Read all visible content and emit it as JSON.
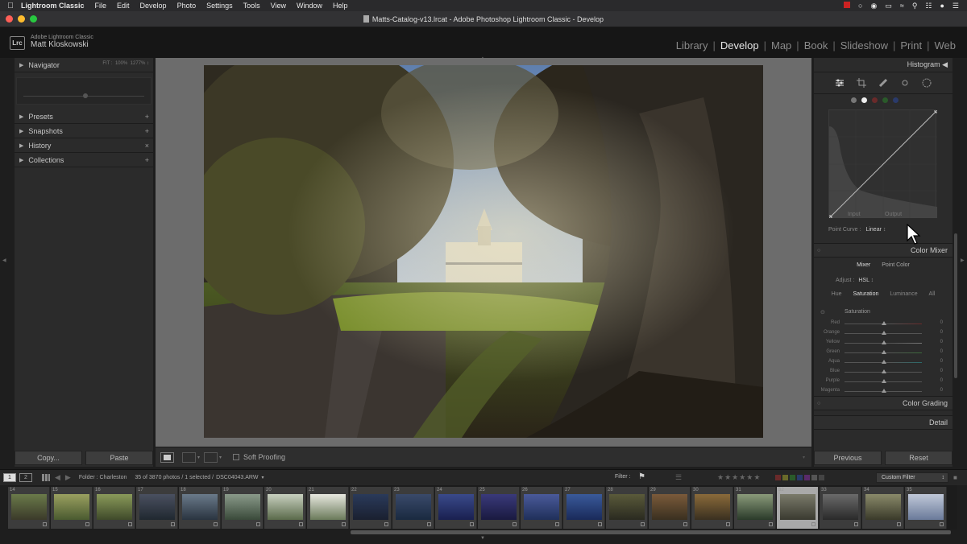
{
  "menubar": {
    "app": "Lightroom Classic",
    "items": [
      "File",
      "Edit",
      "Develop",
      "Photo",
      "Settings",
      "Tools",
      "View",
      "Window",
      "Help"
    ]
  },
  "window": {
    "title": "Matts-Catalog-v13.lrcat - Adobe Photoshop Lightroom Classic - Develop"
  },
  "identity": {
    "logo": "Lrc",
    "product": "Adobe Lightroom Classic",
    "user": "Matt Kloskowski"
  },
  "modules": [
    "Library",
    "Develop",
    "Map",
    "Book",
    "Slideshow",
    "Print",
    "Web"
  ],
  "left_panel": {
    "navigator": "Navigator",
    "nav_zoom": [
      "FIT :",
      "100%",
      "1277%"
    ],
    "sections": [
      {
        "label": "Presets",
        "action": "+"
      },
      {
        "label": "Snapshots",
        "action": "+"
      },
      {
        "label": "History",
        "action": "×"
      },
      {
        "label": "Collections",
        "action": "+"
      }
    ],
    "copy": "Copy...",
    "paste": "Paste"
  },
  "toolbar": {
    "soft_proofing": "Soft Proofing"
  },
  "right_panel": {
    "histogram": "Histogram",
    "curve": {
      "input": "Input",
      "output": "Output",
      "point_curve_label": "Point Curve :",
      "point_curve_value": "Linear"
    },
    "color_mixer": {
      "title": "Color Mixer",
      "tabs": [
        "Mixer",
        "Point Color"
      ],
      "adjust_label": "Adjust :",
      "adjust_value": "HSL",
      "subtabs": [
        "Hue",
        "Saturation",
        "Luminance",
        "All"
      ],
      "saturation": "Saturation",
      "rows": [
        {
          "label": "Red",
          "value": "0"
        },
        {
          "label": "Orange",
          "value": "0"
        },
        {
          "label": "Yellow",
          "value": "0"
        },
        {
          "label": "Green",
          "value": "0"
        },
        {
          "label": "Aqua",
          "value": "0"
        },
        {
          "label": "Blue",
          "value": "0"
        },
        {
          "label": "Purple",
          "value": "0"
        },
        {
          "label": "Magenta",
          "value": "0"
        }
      ]
    },
    "color_grading": "Color Grading",
    "detail": "Detail",
    "previous": "Previous",
    "reset": "Reset"
  },
  "filmbar": {
    "view1": "1",
    "view2": "2",
    "folder": "Folder : Charleston",
    "count": "35 of 3870 photos / 1 selected /",
    "file": "DSC04043.ARW",
    "filter": "Filter :",
    "custom_filter": "Custom Filter"
  },
  "filmstrip": {
    "numbers": [
      "14",
      "15",
      "16",
      "17",
      "18",
      "19",
      "20",
      "21",
      "22",
      "23",
      "24",
      "25",
      "26",
      "27",
      "28",
      "29",
      "30",
      "31",
      "32",
      "33",
      "34",
      "35"
    ],
    "selected_index": 18
  },
  "colors": {
    "accent": "#e6e6e6",
    "panel": "#2b2b2b",
    "background": "#6c6c6c"
  }
}
